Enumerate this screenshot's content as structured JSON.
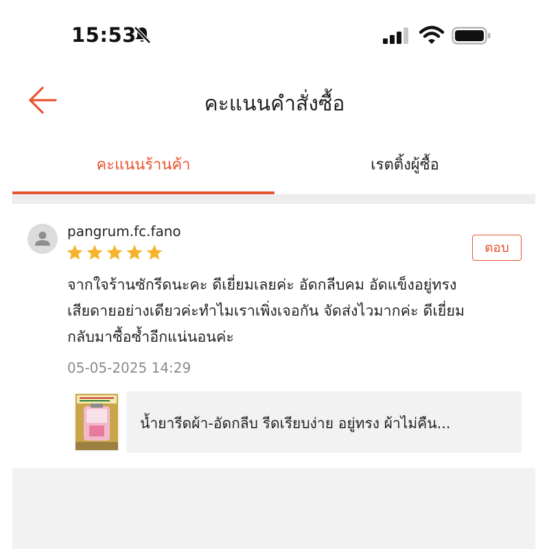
{
  "status_bar": {
    "time": "15:53"
  },
  "header": {
    "title": "คะแนนคำสั่งซื้อ"
  },
  "tabs": [
    {
      "label": "คะแนนร้านค้า",
      "active": true
    },
    {
      "label": "เรตติ้งผู้ซื้อ",
      "active": false
    }
  ],
  "review": {
    "username": "pangrum.fc.fano",
    "rating": 5,
    "reply_label": "ตอบ",
    "text_lines": [
      "จากใจร้านซักรีดนะคะ ดีเยี่ยมเลยค่ะ  อัดกลีบคม  อัดแข็งอยู่ทรง",
      "เสียดายอย่างเดียวค่ะทำไมเราเพิ่งเจอกัน  จัดส่งไวมากค่ะ ดีเยี่ยม",
      "กลับมาซื้อซ้ำอีกแน่นอนค่ะ"
    ],
    "date": "05-05-2025 14:29"
  },
  "product": {
    "name": "น้ำยารีดผ้า-อัดกลีบ รีดเรียบง่าย อยู่ทรง ผ้าไม่คืน..."
  },
  "colors": {
    "accent": "#e8532f",
    "star": "#f7b32b",
    "divider": "#ededed"
  }
}
